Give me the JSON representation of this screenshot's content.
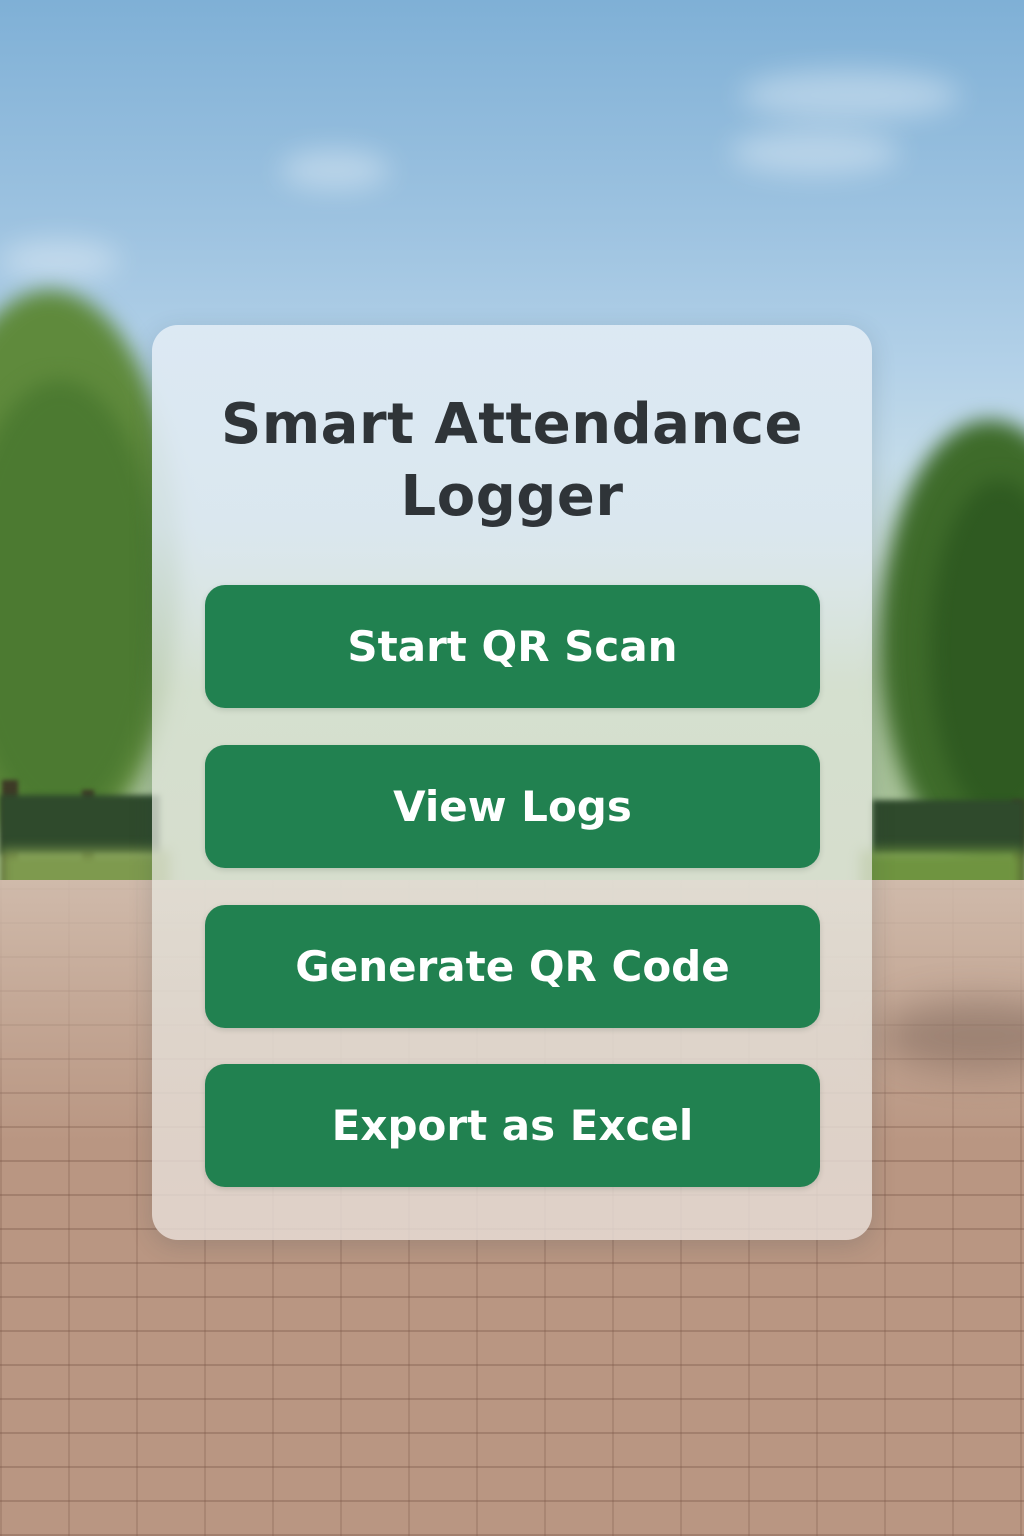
{
  "app": {
    "title_line1": "Smart Attendance",
    "title_line2": "Logger"
  },
  "actions": [
    {
      "label": "Start QR Scan"
    },
    {
      "label": "View Logs"
    },
    {
      "label": "Generate QR Code"
    },
    {
      "label": "Export as Excel"
    }
  ],
  "colors": {
    "button_background": "#218150",
    "button_text": "#ffffff",
    "title_text": "#2f3438"
  }
}
